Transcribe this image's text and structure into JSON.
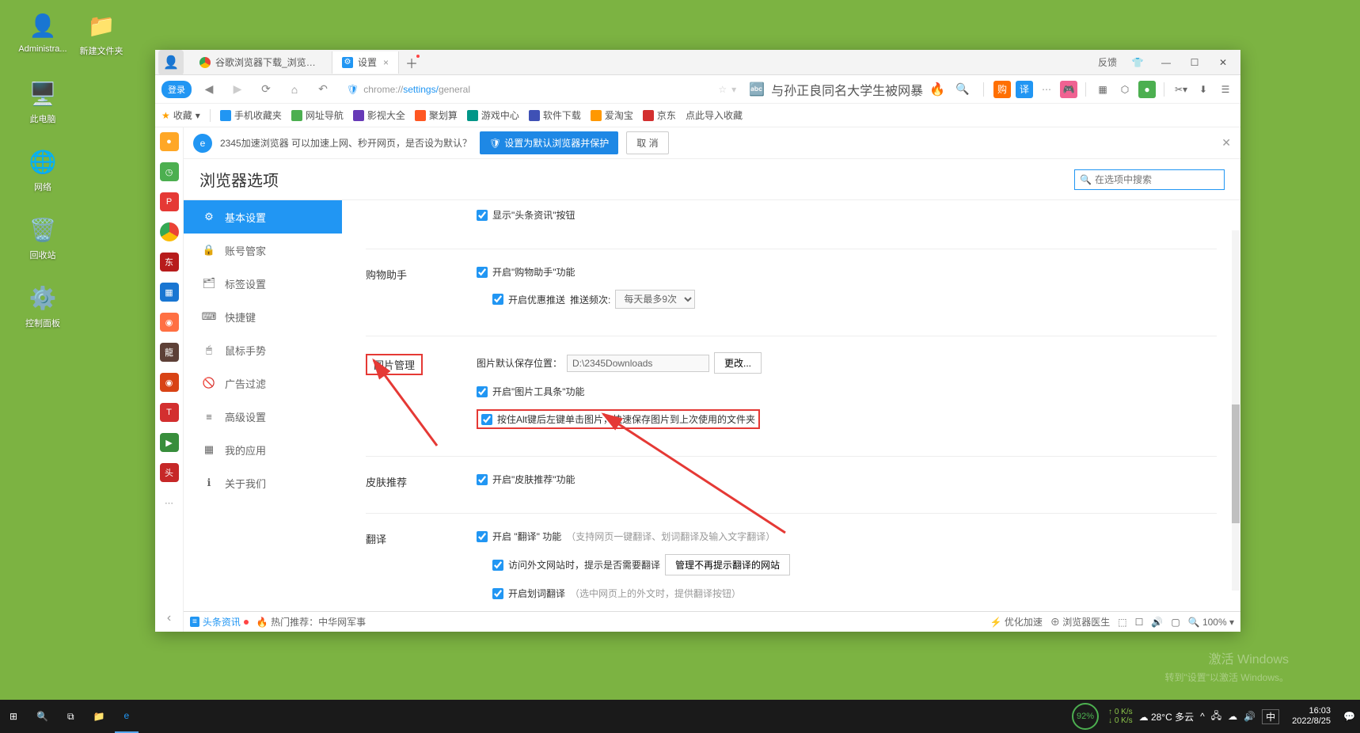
{
  "desktop": {
    "icons": [
      {
        "label": "Administra...",
        "glyph": "👤"
      },
      {
        "label": "新建文件夹",
        "glyph": "📁"
      },
      {
        "label": "此电脑",
        "glyph": "🖥️"
      },
      {
        "label": "网络",
        "glyph": "🌐"
      },
      {
        "label": "回收站",
        "glyph": "🗑️"
      },
      {
        "label": "控制面板",
        "glyph": "⚙️"
      }
    ]
  },
  "window": {
    "feedback": "反馈",
    "tabs": [
      {
        "title": "谷歌浏览器下载_浏览器官网入"
      },
      {
        "title": "设置"
      }
    ],
    "addr": {
      "login": "登录",
      "url_prefix": "chrome://",
      "url_mid": "settings/",
      "url_suffix": "general",
      "right_text": "与孙正良同名大学生被网暴"
    },
    "bookmarks": {
      "fav": "收藏",
      "items": [
        "手机收藏夹",
        "网址导航",
        "影视大全",
        "聚划算",
        "游戏中心",
        "软件下载",
        "爱淘宝",
        "京东",
        "点此导入收藏"
      ]
    },
    "promo": {
      "text": "2345加速浏览器 可以加速上网、秒开网页，是否设为默认？",
      "set_default": "设置为默认浏览器并保护",
      "cancel": "取 消"
    }
  },
  "settings": {
    "title": "浏览器选项",
    "search_placeholder": "在选项中搜索",
    "sidebar": [
      {
        "icon": "⚙",
        "label": "基本设置",
        "active": true
      },
      {
        "icon": "🔒",
        "label": "账号管家"
      },
      {
        "icon": "🗂",
        "label": "标签设置"
      },
      {
        "icon": "⌨",
        "label": "快捷键"
      },
      {
        "icon": "🖱",
        "label": "鼠标手势"
      },
      {
        "icon": "🚫",
        "label": "广告过滤"
      },
      {
        "icon": "≡",
        "label": "高级设置"
      },
      {
        "icon": "▦",
        "label": "我的应用"
      },
      {
        "icon": "ℹ",
        "label": "关于我们"
      }
    ],
    "sections": {
      "top_row_label": "显示\"头条资讯\"按钮",
      "shopping": {
        "label": "购物助手",
        "enable": "开启\"购物助手\"功能",
        "discount": "开启优惠推送",
        "freq_label": "推送频次:",
        "freq_value": "每天最多9次"
      },
      "image": {
        "label": "图片管理",
        "path_label": "图片默认保存位置：",
        "path_value": "D:\\2345Downloads",
        "change": "更改...",
        "toolbar": "开启\"图片工具条\"功能",
        "alt_save": "按住Alt键后左键单击图片，快速保存图片到上次使用的文件夹"
      },
      "skin": {
        "label": "皮肤推荐",
        "enable": "开启\"皮肤推荐\"功能"
      },
      "translate": {
        "label": "翻译",
        "enable": "开启 \"翻译\" 功能",
        "enable_hint": "（支持网页一键翻译、划词翻译及输入文字翻译）",
        "visit": "访问外文网站时，提示是否需要翻译",
        "visit_btn": "管理不再提示翻译的网站",
        "word": "开启划词翻译",
        "word_hint": "（选中网页上的外文时，提供翻译按钮）"
      }
    }
  },
  "statusbar": {
    "news": "头条资讯",
    "hot": "热门推荐：中华网军事",
    "speed": "优化加速",
    "doctor": "浏览器医生",
    "zoom": "100%"
  },
  "watermark": {
    "l1": "激活 Windows",
    "l2": "转到\"设置\"以激活 Windows。"
  },
  "taskbar": {
    "weather": "28°C 多云",
    "ime": "中",
    "pct": "92%",
    "net_up": "0 K/s",
    "net_down": "0 K/s",
    "time": "16:03",
    "date": "2022/8/25"
  }
}
